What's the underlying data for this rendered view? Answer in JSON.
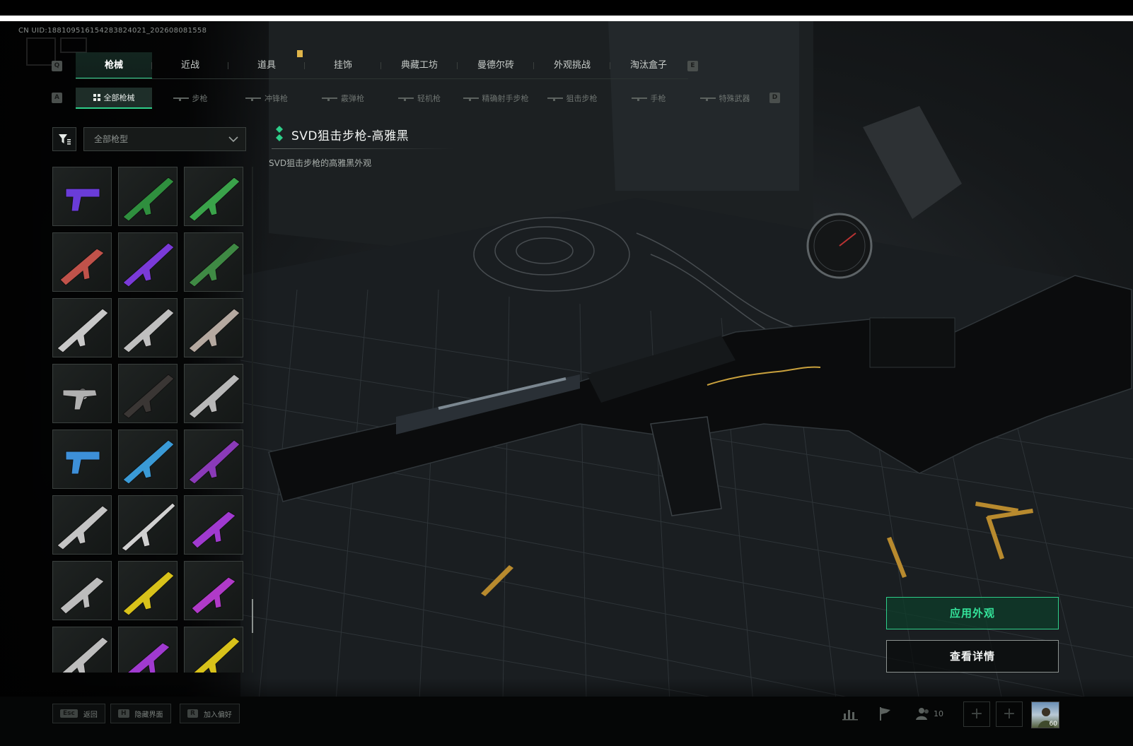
{
  "uid": "CN UID:1881095161542838240​21_202608081558",
  "main_tabs": {
    "prev_key": "Q",
    "next_key": "E",
    "items": [
      "枪械",
      "近战",
      "道具",
      "挂饰",
      "典藏工坊",
      "曼德尔砖",
      "外观挑战",
      "淘汰盒子"
    ],
    "active_index": 0
  },
  "sub_tabs": {
    "prev_key": "A",
    "next_key": "D",
    "items": [
      "全部枪械",
      "步枪",
      "冲锋枪",
      "霰弹枪",
      "轻机枪",
      "精确射手步枪",
      "狙击步枪",
      "手枪",
      "特殊武器"
    ],
    "active_index": 0
  },
  "filter": {
    "select_value": "全部枪型"
  },
  "item": {
    "title": "SVD狙击步枪-高雅黑",
    "description": "SVD狙击步枪的高雅黑外观",
    "rarity_color": "#2ecf8a"
  },
  "skins": [
    {
      "icon": "pistol",
      "color": "#6a3cd8"
    },
    {
      "icon": "rifle",
      "color": "#2f8f3e"
    },
    {
      "icon": "rifle",
      "color": "#3aa34a"
    },
    {
      "icon": "smg",
      "color": "#c0524a"
    },
    {
      "icon": "rifle",
      "color": "#7a3ad8"
    },
    {
      "icon": "rifle",
      "color": "#3f8a44"
    },
    {
      "icon": "rifle",
      "color": "#c8c8c8"
    },
    {
      "icon": "rifle",
      "color": "#bfbfbf"
    },
    {
      "icon": "rifle",
      "color": "#b5a9a0"
    },
    {
      "icon": "revolver",
      "color": "#b0b0b0"
    },
    {
      "icon": "rifle",
      "color": "#3a3634"
    },
    {
      "icon": "rifle",
      "color": "#b8b8b8"
    },
    {
      "icon": "pistol",
      "color": "#3d8fd8"
    },
    {
      "icon": "rifle",
      "color": "#3a9ad6"
    },
    {
      "icon": "rifle",
      "color": "#8a3ab8"
    },
    {
      "icon": "rifle",
      "color": "#c4c4c4"
    },
    {
      "icon": "sniper",
      "color": "#d0d0d0"
    },
    {
      "icon": "smg",
      "color": "#a03ad0"
    },
    {
      "icon": "smg",
      "color": "#bcbcbc"
    },
    {
      "icon": "rifle",
      "color": "#d8c21a"
    },
    {
      "icon": "smg",
      "color": "#b03ac8"
    },
    {
      "icon": "rifle",
      "color": "#bdbdbd"
    },
    {
      "icon": "smg",
      "color": "#a03ad0"
    },
    {
      "icon": "rifle",
      "color": "#d8c21a"
    }
  ],
  "buttons": {
    "apply": "应用外观",
    "details": "查看详情"
  },
  "hints": [
    {
      "key": "Esc",
      "label": "返回"
    },
    {
      "key": "H",
      "label": "隐藏界面"
    },
    {
      "key": "R",
      "label": "加入偏好"
    }
  ],
  "system": {
    "friends_count": "10",
    "player_level": "60"
  },
  "colors": {
    "accent": "#2ecf8a",
    "accent_text": "#34e39a",
    "tab_marker": "#e0b54a"
  }
}
